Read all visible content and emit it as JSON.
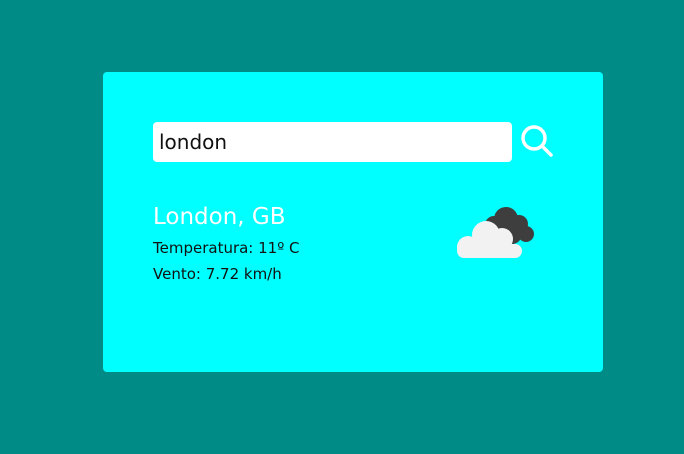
{
  "search": {
    "value": "london"
  },
  "weather": {
    "city": "London, GB",
    "temperature_label": "Temperatura: 11º C",
    "wind_label": "Vento: 7.72 km/h",
    "icon": "cloudy-icon"
  },
  "colors": {
    "background": "#008b87",
    "card": "#00ffff",
    "accent_text": "#ffffff"
  },
  "icons": {
    "search": "search-icon",
    "weather": "cloudy-icon"
  }
}
